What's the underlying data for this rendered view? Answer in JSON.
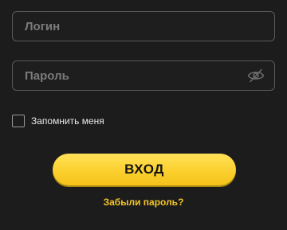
{
  "login_form": {
    "login": {
      "placeholder": "Логин",
      "value": ""
    },
    "password": {
      "placeholder": "Пароль",
      "value": "",
      "toggle_icon": "eye-slash-icon"
    },
    "remember_me": {
      "label": "Запомнить меня",
      "checked": false
    },
    "submit_label": "ВХОД",
    "forgot_password_label": "Забыли пароль?"
  },
  "colors": {
    "background": "#1c1c1c",
    "field_border": "#5a5a5a",
    "accent_yellow": "#fcd02e",
    "link_yellow": "#f3c52a",
    "placeholder": "#7b7b7b"
  }
}
